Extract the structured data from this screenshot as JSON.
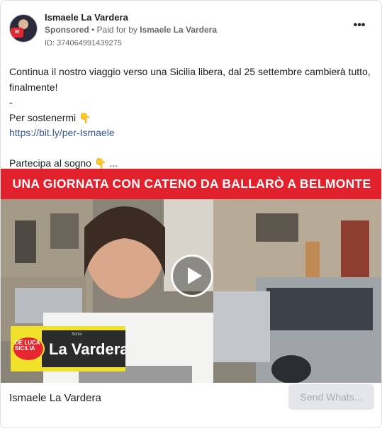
{
  "post": {
    "author": "Ismaele La Vardera",
    "sponsored_label": "Sponsored",
    "paid_prefix": " • Paid for by ",
    "payer": "Ismaele La Vardera",
    "ad_id": "ID: 374064991439275",
    "more_icon": "more-horizontal-icon",
    "more_label": "•••"
  },
  "body": {
    "line1": "Continua il nostro viaggio verso una Sicilia libera, dal 25 settembre cambierà tutto, finalmente!",
    "line2": "-",
    "line3": "Per sostenermi",
    "link": "https://bit.ly/per-Ismaele",
    "line5": "",
    "line6": "Partecipa al sogno",
    "ellipsis": "..."
  },
  "media": {
    "banner_text": "UNA GIORNATA CON CATENO DA BALLARÒ A BELMONTE",
    "banner_color": "#e1222d",
    "play_icon": "play-icon",
    "logo_name": "La Vardera",
    "logo_scrivi": "Scrivi",
    "logo_seal_line1": "DE LUCA",
    "logo_seal_line2": "SICILIA"
  },
  "footer": {
    "title": "Ismaele La Vardera",
    "cta_label": "Send Whats..."
  },
  "colors": {
    "link": "#385898",
    "muted": "#65676b",
    "accent_yellow": "#f0e22b"
  }
}
